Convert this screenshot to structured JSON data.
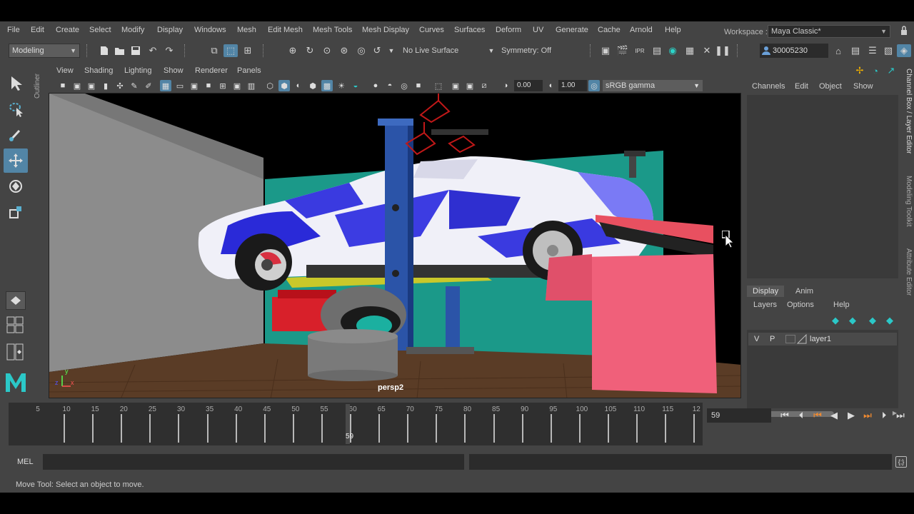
{
  "menu": [
    "File",
    "Edit",
    "Create",
    "Select",
    "Modify",
    "Display",
    "Windows",
    "Mesh",
    "Edit Mesh",
    "Mesh Tools",
    "Mesh Display",
    "Curves",
    "Surfaces",
    "Deform",
    "UV",
    "Generate",
    "Cache",
    "Arnold",
    "Help"
  ],
  "workspace": {
    "label": "Workspace :",
    "value": "Maya Classic*"
  },
  "statusline": {
    "mode": "Modeling",
    "live_surface": "No Live Surface",
    "symmetry": "Symmetry: Off",
    "user": "30005230"
  },
  "outliner_tab": "Outliner",
  "panel": {
    "menus": [
      "View",
      "Shading",
      "Lighting",
      "Show",
      "Renderer",
      "Panels"
    ],
    "exposure": "0.00",
    "gamma": "1.00",
    "color_space": "sRGB gamma",
    "camera": "persp2",
    "axis_y": "y",
    "axis_x": "x",
    "axis_z": "z"
  },
  "channel_box": {
    "tabs": [
      "Channels",
      "Edit",
      "Object",
      "Show"
    ]
  },
  "layer_editor": {
    "tabs": [
      "Display",
      "Anim"
    ],
    "active_tab": "Display",
    "menus": [
      "Layers",
      "Options",
      "Help"
    ],
    "layers": [
      {
        "v": "V",
        "p": "P",
        "name": "layer1"
      }
    ]
  },
  "side_tabs": [
    "Channel Box / Layer Editor",
    "Modeling Toolkit",
    "Attribute Editor"
  ],
  "timeslider": {
    "labels": [
      "5",
      "10",
      "15",
      "20",
      "25",
      "30",
      "35",
      "40",
      "45",
      "50",
      "55",
      "60",
      "65",
      "70",
      "75",
      "80",
      "85",
      "90",
      "95",
      "100",
      "105",
      "110",
      "115",
      "12"
    ],
    "current": "59",
    "current_frame_field": "59"
  },
  "cmdline": {
    "label": "MEL",
    "script_icon": "{;}"
  },
  "help_line": "Move Tool: Select an object to move.",
  "colors": {
    "accent": "#5285a6",
    "bg": "#444444",
    "field": "#2b2b2b"
  }
}
